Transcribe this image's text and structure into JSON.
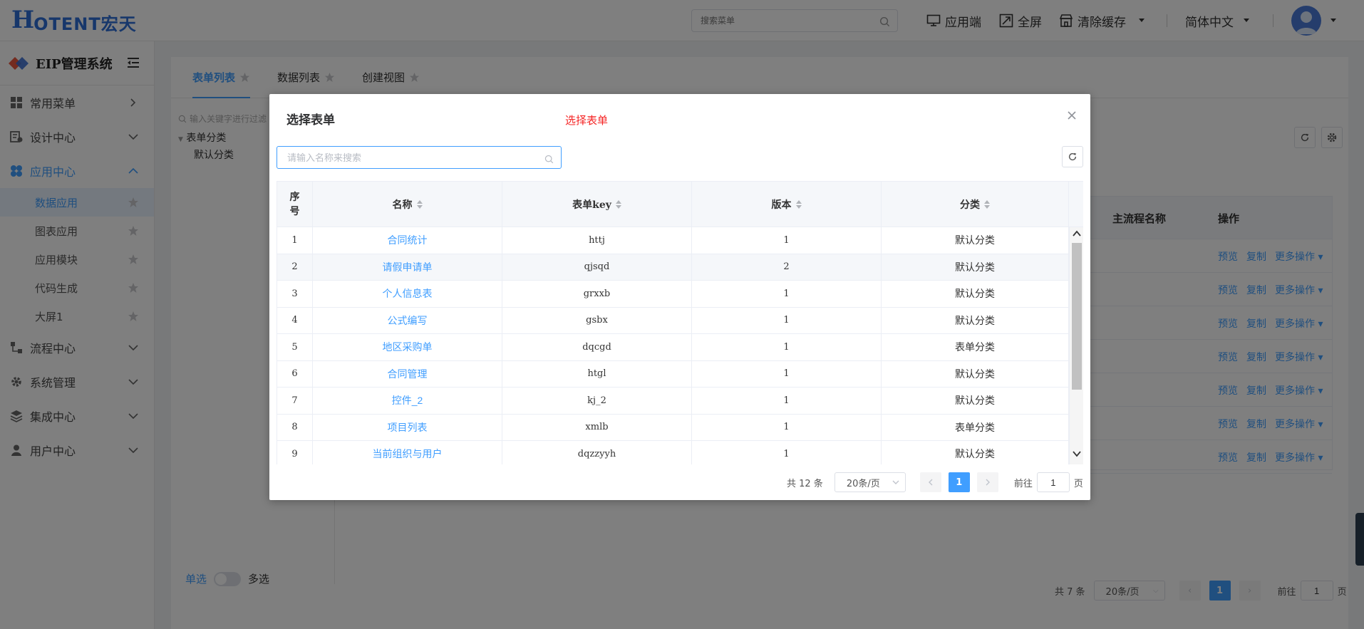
{
  "header": {
    "logo_mark": "H",
    "logo_text": "OTENT宏天",
    "search_placeholder": "搜索菜单",
    "app_port": "应用端",
    "fullscreen": "全屏",
    "clear_cache": "清除缓存",
    "language": "简体中文"
  },
  "sidebar": {
    "system_title": "EIP管理系统",
    "menus": [
      {
        "label": "常用菜单"
      },
      {
        "label": "设计中心"
      },
      {
        "label": "应用中心"
      },
      {
        "label": "流程中心"
      },
      {
        "label": "系统管理"
      },
      {
        "label": "集成中心"
      },
      {
        "label": "用户中心"
      }
    ],
    "app_center_items": [
      {
        "label": "数据应用"
      },
      {
        "label": "图表应用"
      },
      {
        "label": "应用模块"
      },
      {
        "label": "代码生成"
      },
      {
        "label": "大屏1"
      }
    ]
  },
  "main": {
    "tabs": [
      {
        "label": "表单列表"
      },
      {
        "label": "数据列表"
      },
      {
        "label": "创建视图"
      }
    ],
    "tree_search_placeholder": "输入关键字进行过滤",
    "tree_root": "表单分类",
    "tree_child": "默认分类",
    "single_select": "单选",
    "multi_select": "多选",
    "bg_table_headers": {
      "flow_name": "主流程名称",
      "ops": "操作"
    },
    "bg_row_ops": {
      "preview": "预览",
      "copy": "复制",
      "more": "更多操作"
    },
    "bg_pager": {
      "total": "共 7 条",
      "page_size": "20条/页",
      "current_page": "1",
      "goto_label": "前往",
      "goto_value": "1",
      "page_unit": "页"
    }
  },
  "modal": {
    "title": "选择表单",
    "subtitle": "选择表单",
    "search_placeholder": "请输入名称来搜索",
    "columns": {
      "seq": "序号",
      "name": "名称",
      "key": "表单key",
      "version": "版本",
      "category": "分类"
    },
    "rows": [
      {
        "seq": "1",
        "name": "合同统计",
        "key": "httj",
        "version": "1",
        "category": "默认分类"
      },
      {
        "seq": "2",
        "name": "请假申请单",
        "key": "qjsqd",
        "version": "2",
        "category": "默认分类"
      },
      {
        "seq": "3",
        "name": "个人信息表",
        "key": "grxxb",
        "version": "1",
        "category": "默认分类"
      },
      {
        "seq": "4",
        "name": "公式编写",
        "key": "gsbx",
        "version": "1",
        "category": "默认分类"
      },
      {
        "seq": "5",
        "name": "地区采购单",
        "key": "dqcgd",
        "version": "1",
        "category": "表单分类"
      },
      {
        "seq": "6",
        "name": "合同管理",
        "key": "htgl",
        "version": "1",
        "category": "默认分类"
      },
      {
        "seq": "7",
        "name": "控件_2",
        "key": "kj_2",
        "version": "1",
        "category": "默认分类"
      },
      {
        "seq": "8",
        "name": "项目列表",
        "key": "xmlb",
        "version": "1",
        "category": "表单分类"
      },
      {
        "seq": "9",
        "name": "当前组织与用户",
        "key": "dqzzyyh",
        "version": "1",
        "category": "默认分类"
      }
    ],
    "pager": {
      "total": "共 12 条",
      "page_size": "20条/页",
      "current_page": "1",
      "goto_label": "前往",
      "goto_value": "1",
      "page_unit": "页"
    }
  },
  "colors": {
    "accent": "#409eff",
    "brand": "#2f6fd6",
    "subtitle_red": "#f52424",
    "overlay": "rgba(0,0,0,0.5)"
  }
}
